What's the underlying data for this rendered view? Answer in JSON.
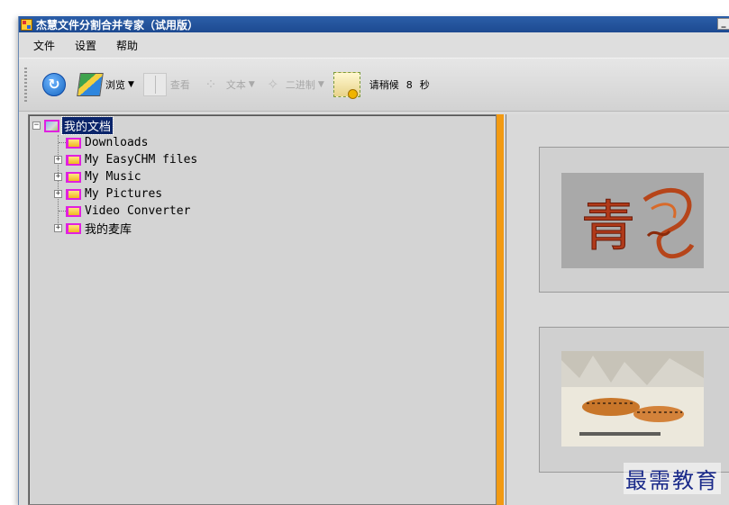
{
  "window": {
    "title": "杰慧文件分割合并专家（试用版）"
  },
  "menu": {
    "items": [
      "文件",
      "设置",
      "帮助"
    ]
  },
  "toolbar": {
    "browse_label": "浏览",
    "view_label": "查看",
    "text_label": "文本",
    "binary_label": "二进制",
    "wait_label": "请稍候",
    "wait_seconds": "8",
    "seconds_unit": "秒"
  },
  "tree": {
    "root": "我的文档",
    "items": [
      {
        "label": "Downloads",
        "expandable": false
      },
      {
        "label": "My EasyCHM files",
        "expandable": true
      },
      {
        "label": "My Music",
        "expandable": true
      },
      {
        "label": "My Pictures",
        "expandable": true
      },
      {
        "label": "Video Converter",
        "expandable": false
      },
      {
        "label": "我的麦库",
        "expandable": true
      }
    ]
  },
  "preview": {
    "thumbnails": [
      "calligraphy-dragon-image",
      "tigers-painting-image"
    ]
  },
  "watermark": "最需教育",
  "colors": {
    "title_bar": "#1d4a91",
    "splitter": "#f29a12",
    "selection": "#0a246a",
    "folder_border": "#e020e0"
  }
}
